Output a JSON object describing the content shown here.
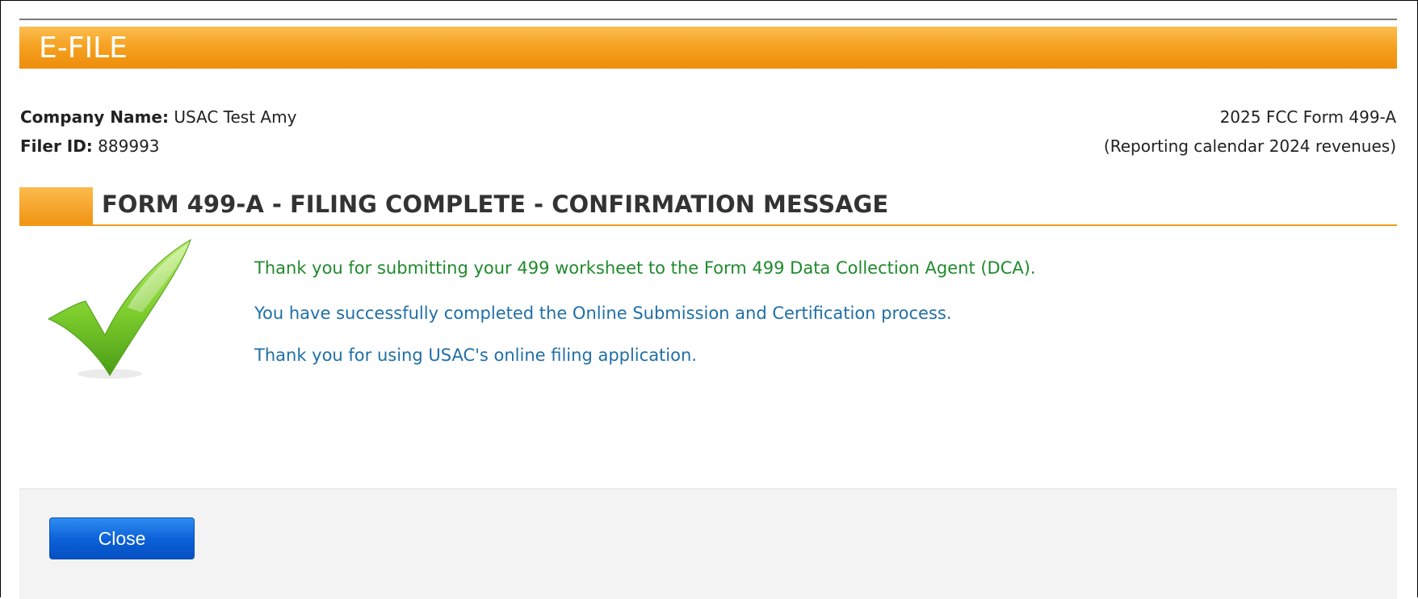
{
  "header": {
    "title": "E-FILE"
  },
  "company": {
    "name_label": "Company Name:",
    "name_value": "USAC Test Amy",
    "filer_label": "Filer ID:",
    "filer_value": "889993"
  },
  "form_info": {
    "form_name": "2025 FCC Form 499-A",
    "reporting": "(Reporting calendar 2024 revenues)"
  },
  "section": {
    "title": "FORM 499-A - FILING COMPLETE - CONFIRMATION MESSAGE"
  },
  "messages": {
    "line1": "Thank you for submitting your 499 worksheet to the Form 499 Data Collection Agent (DCA).",
    "line2": "You have successfully completed the Online Submission and Certification process.",
    "line3": "Thank you for using USAC's online filing application."
  },
  "actions": {
    "close_label": "Close"
  },
  "colors": {
    "accent_orange": "#f5a01f",
    "success_green": "#1f8a2c",
    "info_blue": "#1f6fa6",
    "button_blue": "#0b5fd6"
  },
  "icons": {
    "success": "checkmark-icon"
  }
}
